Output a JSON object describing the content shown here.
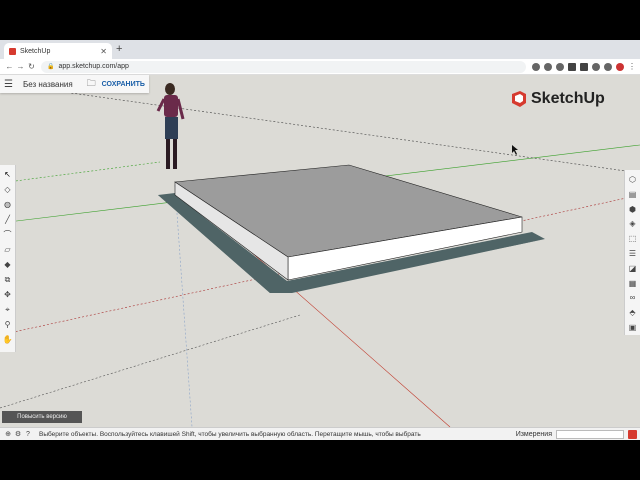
{
  "browser": {
    "tab_title": "SketchUp",
    "tab_close": "✕",
    "new_tab": "+",
    "url": "app.sketchup.com/app",
    "back": "←",
    "forward": "→",
    "reload": "↻",
    "menu": "⋮"
  },
  "app": {
    "file_title": "Без названия",
    "save_label": "СОХРАНИТЬ",
    "logo_text": "SketchUp",
    "upgrade_label": "Повысить версию"
  },
  "left_tools": [
    {
      "name": "select-icon",
      "glyph": "↖"
    },
    {
      "name": "eraser-icon",
      "glyph": "◇"
    },
    {
      "name": "paint-bucket-icon",
      "glyph": "◍"
    },
    {
      "name": "line-icon",
      "glyph": "╱"
    },
    {
      "name": "arc-icon",
      "glyph": "⌒"
    },
    {
      "name": "rectangle-icon",
      "glyph": "▱"
    },
    {
      "name": "push-pull-icon",
      "glyph": "◆"
    },
    {
      "name": "offset-icon",
      "glyph": "⧉"
    },
    {
      "name": "move-icon",
      "glyph": "✥"
    },
    {
      "name": "tape-measure-icon",
      "glyph": "⌖"
    },
    {
      "name": "orbit-icon",
      "glyph": "⚲"
    },
    {
      "name": "pan-icon",
      "glyph": "✋"
    }
  ],
  "right_tools": [
    {
      "name": "entity-info-icon",
      "glyph": "⬡"
    },
    {
      "name": "instructor-icon",
      "glyph": "▤"
    },
    {
      "name": "components-icon",
      "glyph": "⬢"
    },
    {
      "name": "materials-icon",
      "glyph": "◈"
    },
    {
      "name": "styles-icon",
      "glyph": "⬚"
    },
    {
      "name": "layers-icon",
      "glyph": "☰"
    },
    {
      "name": "tag-icon",
      "glyph": "◪"
    },
    {
      "name": "scenes-icon",
      "glyph": "▦"
    },
    {
      "name": "display-icon",
      "glyph": "∞"
    },
    {
      "name": "solid-tools-icon",
      "glyph": "⬘"
    },
    {
      "name": "model-info-icon",
      "glyph": "▣"
    }
  ],
  "status": {
    "text": "Выберите объекты. Воспользуйтесь клавишей Shift, чтобы увеличить выбранную область. Перетащите мышь, чтобы выбрать",
    "measure_label": "Измерения"
  },
  "colors": {
    "viewport_bg": "#dcdbd6",
    "slab_top": "#9c9c9c",
    "slab_side": "#ffffff",
    "shadow": "#4f6466",
    "axis_green": "#3aa02a",
    "axis_red": "#c0392b",
    "brand_red": "#d63a2f"
  }
}
